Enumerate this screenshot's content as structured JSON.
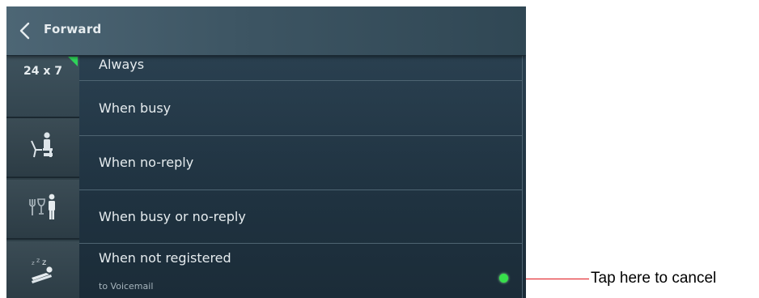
{
  "header": {
    "title": "Forward",
    "back_icon": "chevron-left-icon"
  },
  "sidebar": {
    "tabs": [
      {
        "label": "24 x 7",
        "active": true,
        "icon": null
      },
      {
        "label": "",
        "active": false,
        "icon": "person-at-desk-icon"
      },
      {
        "label": "",
        "active": false,
        "icon": "fork-glass-person-icon"
      },
      {
        "label": "",
        "active": false,
        "icon": "sleeping-zzz-icon"
      }
    ],
    "active_indicator_color": "#2fd45a"
  },
  "list": {
    "items": [
      {
        "label": "Always",
        "sublabel": "",
        "selected": false,
        "partially_scrolled": true
      },
      {
        "label": "When busy",
        "sublabel": "",
        "selected": false
      },
      {
        "label": "When no-reply",
        "sublabel": "",
        "selected": false
      },
      {
        "label": "When busy or no-reply",
        "sublabel": "",
        "selected": false
      },
      {
        "label": "When not registered",
        "sublabel": "to Voicemail",
        "selected": true
      }
    ],
    "selected_dot_color": "#37e04b"
  },
  "annotation": {
    "text": "Tap here to cancel",
    "color": "#e0141a"
  }
}
